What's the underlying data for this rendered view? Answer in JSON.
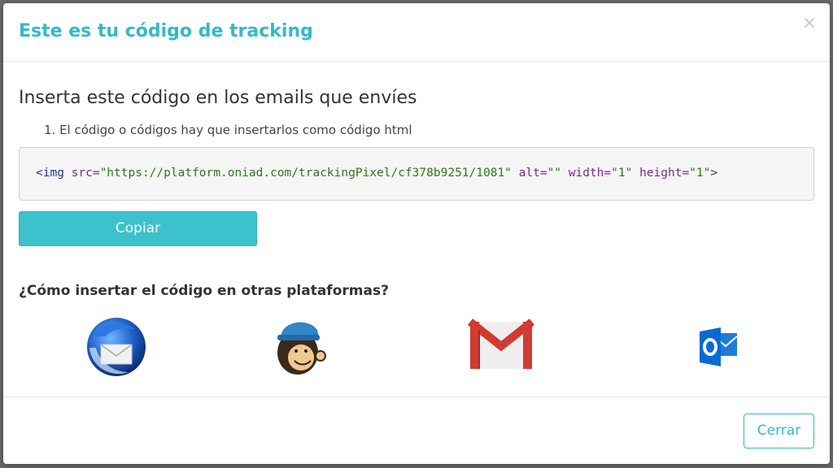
{
  "modal": {
    "title": "Este es tu código de tracking",
    "close_glyph": "×"
  },
  "instructions": {
    "heading": "Inserta este código en los emails que envíes",
    "step": "1. El código o códigos hay que insertarlos como código html"
  },
  "code": {
    "tag_open": "<img",
    "attr_src": "src=",
    "val_src": "\"https://platform.oniad.com/trackingPixel/cf378b9251/1081\"",
    "attr_alt": "alt=",
    "val_alt": "\"\"",
    "attr_width": "width=",
    "val_width": "\"1\"",
    "attr_height": "height=",
    "val_height": "\"1\"",
    "tag_close": ">"
  },
  "copy_button": {
    "label": "Copiar"
  },
  "platforms": {
    "heading": "¿Cómo insertar el código en otras plataformas?",
    "items": [
      {
        "icon": "thunderbird-icon"
      },
      {
        "icon": "mailchimp-icon"
      },
      {
        "icon": "gmail-icon"
      },
      {
        "icon": "outlook-icon"
      }
    ]
  },
  "footer": {
    "close_label": "Cerrar"
  },
  "colors": {
    "accent": "#35b8c8",
    "button_fill": "#3cc1cd"
  }
}
